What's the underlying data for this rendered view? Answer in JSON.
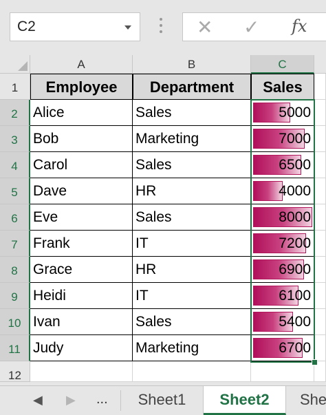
{
  "name_box": {
    "value": "C2"
  },
  "formula_bar": {
    "cancel_icon": "x-icon",
    "enter_icon": "check-icon",
    "fx_label": "fx"
  },
  "columns": [
    "A",
    "B",
    "C"
  ],
  "rows": [
    "1",
    "2",
    "3",
    "4",
    "5",
    "6",
    "7",
    "8",
    "9",
    "10",
    "11",
    "12"
  ],
  "headers": {
    "employee": "Employee",
    "department": "Department",
    "sales": "Sales"
  },
  "records": [
    {
      "employee": "Alice",
      "department": "Sales",
      "sales": "5000"
    },
    {
      "employee": "Bob",
      "department": "Marketing",
      "sales": "7000"
    },
    {
      "employee": "Carol",
      "department": "Sales",
      "sales": "6500"
    },
    {
      "employee": "Dave",
      "department": "HR",
      "sales": "4000"
    },
    {
      "employee": "Eve",
      "department": "Sales",
      "sales": "8000"
    },
    {
      "employee": "Frank",
      "department": "IT",
      "sales": "7200"
    },
    {
      "employee": "Grace",
      "department": "HR",
      "sales": "6900"
    },
    {
      "employee": "Heidi",
      "department": "IT",
      "sales": "6100"
    },
    {
      "employee": "Ivan",
      "department": "Sales",
      "sales": "5400"
    },
    {
      "employee": "Judy",
      "department": "Marketing",
      "sales": "6700"
    }
  ],
  "data_bar": {
    "max_value": 8000,
    "color": "#b0105a"
  },
  "sheet_tabs": {
    "nav_prev": "◀",
    "nav_next": "▶",
    "more": "...",
    "tabs": [
      "Sheet1",
      "Sheet2",
      "She"
    ],
    "active": "Sheet2"
  },
  "colors": {
    "accent": "#217346",
    "header_fill": "#d9d9d9"
  }
}
